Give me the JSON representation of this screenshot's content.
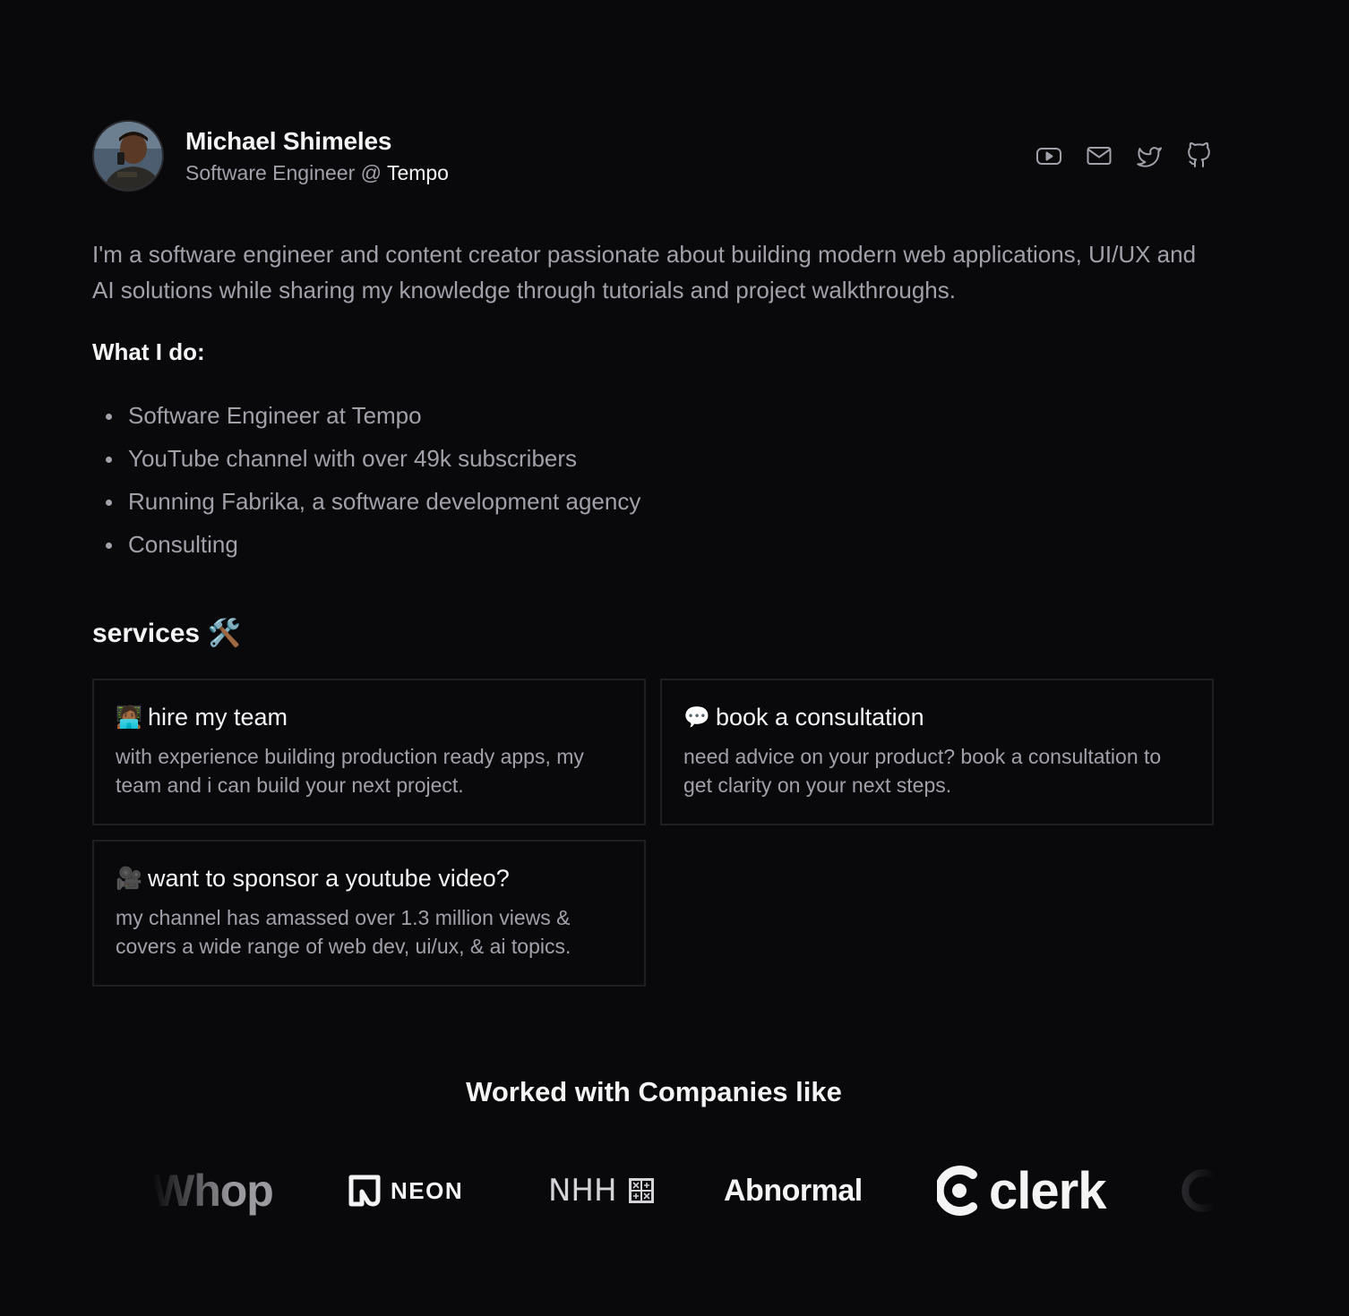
{
  "profile": {
    "name": "Michael Shimeles",
    "role_prefix": "Software Engineer @ ",
    "company": "Tempo",
    "avatar": "avatar-photo"
  },
  "socials": [
    {
      "icon": "youtube-icon"
    },
    {
      "icon": "mail-icon"
    },
    {
      "icon": "twitter-icon"
    },
    {
      "icon": "github-icon"
    }
  ],
  "bio": "I'm a software engineer and content creator passionate about building modern web applications, UI/UX and AI solutions while sharing my knowledge through tutorials and project walkthroughs.",
  "what_i_do": {
    "heading": "What I do:",
    "items": [
      "Software Engineer at Tempo",
      "YouTube channel with over 49k subscribers",
      "Running Fabrika, a software development agency",
      "Consulting"
    ]
  },
  "services": {
    "title": "services 🛠️",
    "cards": [
      {
        "emoji": "🧑🏾‍💻",
        "title": "hire my team",
        "description": "with experience building production ready apps, my team and i can build your next project."
      },
      {
        "emoji": "💬",
        "title": "book a consultation",
        "description": "need advice on your product? book a consultation to get clarity on your next steps."
      },
      {
        "emoji": "🎥",
        "title": "want to sponsor a youtube video?",
        "description": "my channel has amassed over 1.3 million views & covers a wide range of web dev, ui/ux, & ai topics."
      }
    ]
  },
  "companies": {
    "title": "Worked with Companies like",
    "logos": {
      "whop": "Whop",
      "neon": "NEON",
      "nhh": "NHH",
      "abnormal": "Abnormal",
      "clerk": "clerk"
    }
  },
  "colors": {
    "background": "#09090b",
    "text_primary": "#f4f4f5",
    "text_muted": "#a1a1aa",
    "card_border": "#1f1f23"
  }
}
